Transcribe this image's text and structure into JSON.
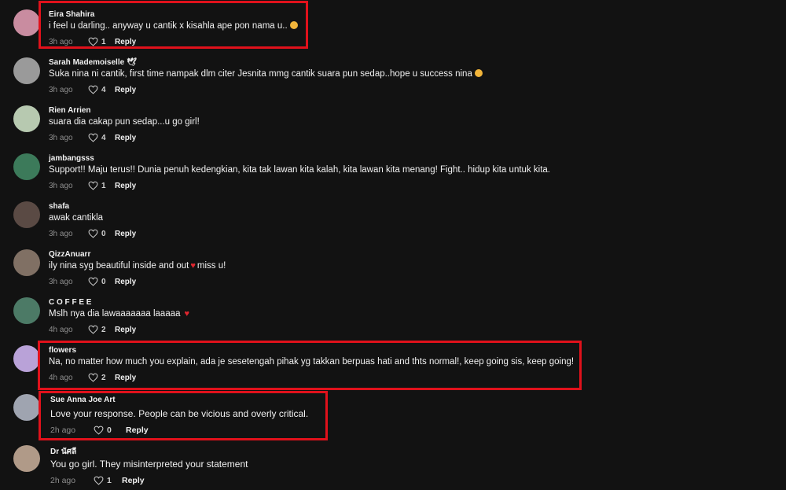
{
  "comments": [
    {
      "username": "Eira Shahira",
      "text": "i feel u darling.. anyway u cantik x kisahla ape pon nama u..",
      "time": "3h ago",
      "likes": "1",
      "reply": "Reply",
      "emoji": "smiling-face-with-heart-eyes",
      "avatar_color": "#c98ca0"
    },
    {
      "username": "Sarah Mademoiselle",
      "badge": "🕊",
      "text": "Suka nina ni cantik, first time nampak dlm citer Jesnita mmg cantik suara pun sedap..hope u success nina",
      "time": "3h ago",
      "likes": "4",
      "reply": "Reply",
      "emoji": "smiling-face-with-heart-eyes",
      "avatar_color": "#9a9a9a"
    },
    {
      "username": "Rien Arrien",
      "text": "suara dia cakap pun sedap...u go girl!",
      "time": "3h ago",
      "likes": "4",
      "reply": "Reply",
      "avatar_color": "#b7c9b0"
    },
    {
      "username": "jambangsss",
      "text": "Support!! Maju terus!! Dunia penuh kedengkian, kita tak lawan kita kalah, kita lawan kita menang! Fight.. hidup kita untuk kita.",
      "time": "3h ago",
      "likes": "1",
      "reply": "Reply",
      "avatar_color": "#3c7a5a"
    },
    {
      "username": "shafa",
      "text": "awak cantikla",
      "time": "3h ago",
      "likes": "0",
      "reply": "Reply",
      "avatar_color": "#5a4a44"
    },
    {
      "username": "QizzAnuarr",
      "text": "ily nina syg beautiful inside and out",
      "text2": "miss u!",
      "time": "3h ago",
      "likes": "0",
      "reply": "Reply",
      "avatar_color": "#807064"
    },
    {
      "username": "C O F F E E",
      "text": "Mslh nya dia lawaaaaaaa laaaaa",
      "time": "4h ago",
      "likes": "2",
      "reply": "Reply",
      "avatar_color": "#4c7a66"
    },
    {
      "username": "flowers",
      "text": "Na, no matter how much you explain, ada je sesetengah pihak yg takkan berpuas hati and thts normal!, keep going sis, keep going!",
      "time": "4h ago",
      "likes": "2",
      "reply": "Reply",
      "avatar_color": "#b9a2d8"
    },
    {
      "username": "Sue Anna Joe Art",
      "text": "Love your response. People can be vicious and overly critical.",
      "time": "2h ago",
      "likes": "0",
      "reply": "Reply",
      "avatar_color": "#9fa4b0"
    },
    {
      "username": "Dr นัศลี",
      "text": "You go girl. They misinterpreted your statement",
      "time": "2h ago",
      "likes": "1",
      "reply": "Reply",
      "avatar_color": "#b09a88"
    }
  ]
}
